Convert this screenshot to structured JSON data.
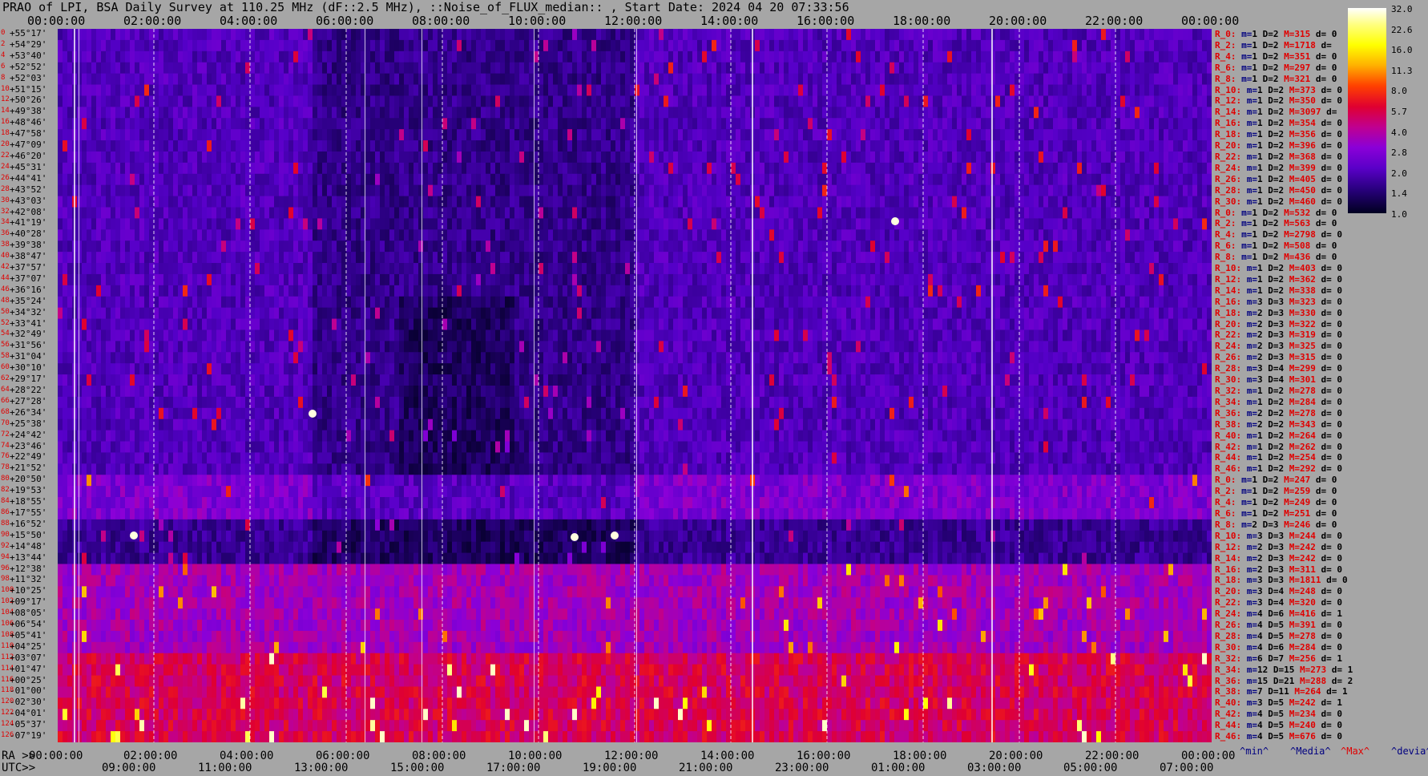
{
  "title": "PRAO of LPI, BSA Daily Survey at 110.25 MHz (dF::2.5 MHz), ::Noise_of_FLUX_median:: , Start Date: 2024 04 20 07:33:56",
  "chart_data": {
    "type": "heatmap",
    "title": "PRAO of LPI, BSA Daily Survey at 110.25 MHz (dF::2.5 MHz), ::Noise_of_FLUX_median:: , Start Date: 2024 04 20 07:33:56",
    "x_top_ticks": [
      "00:00:00",
      "02:00:00",
      "04:00:00",
      "06:00:00",
      "08:00:00",
      "10:00:00",
      "12:00:00",
      "14:00:00",
      "16:00:00",
      "18:00:00",
      "20:00:00",
      "22:00:00",
      "00:00:00"
    ],
    "x_bottom_ra_prefix": "RA >>",
    "x_bottom_ra_ticks": [
      "00:00:00",
      "02:00:00",
      "04:00:00",
      "06:00:00",
      "08:00:00",
      "10:00:00",
      "12:00:00",
      "14:00:00",
      "16:00:00",
      "18:00:00",
      "20:00:00",
      "22:00:00",
      "00:00:00"
    ],
    "x_bottom_utc_prefix": "UTC>>",
    "x_bottom_utc_ticks": [
      "09:00:00",
      "11:00:00",
      "13:00:00",
      "15:00:00",
      "17:00:00",
      "19:00:00",
      "21:00:00",
      "23:00:00",
      "01:00:00",
      "03:00:00",
      "05:00:00",
      "07:00:00"
    ],
    "colorbar_ticks": [
      "32.0",
      "22.6",
      "16.0",
      "11.3",
      "8.0",
      "5.7",
      "4.0",
      "2.8",
      "2.0",
      "1.4",
      "1.0"
    ],
    "footer_labels": [
      "^min^",
      "^Media^",
      "^Max^",
      "^devia^"
    ],
    "rows": [
      {
        "i": "0",
        "dec": "+55°17'",
        "r": "R_0:",
        "m": "1",
        "D": "2",
        "M": "315",
        "d": "0"
      },
      {
        "i": "2",
        "dec": "+54°29'",
        "r": "R_2:",
        "m": "1",
        "D": "2",
        "M": "1718",
        "d": ""
      },
      {
        "i": "4",
        "dec": "+53°40'",
        "r": "R_4:",
        "m": "1",
        "D": "2",
        "M": "351",
        "d": "0"
      },
      {
        "i": "6",
        "dec": "+52°52'",
        "r": "R_6:",
        "m": "1",
        "D": "2",
        "M": "297",
        "d": "0"
      },
      {
        "i": "8",
        "dec": "+52°03'",
        "r": "R_8:",
        "m": "1",
        "D": "2",
        "M": "321",
        "d": "0"
      },
      {
        "i": "10",
        "dec": "+51°15'",
        "r": "R_10:",
        "m": "1",
        "D": "2",
        "M": "373",
        "d": "0"
      },
      {
        "i": "12",
        "dec": "+50°26'",
        "r": "R_12:",
        "m": "1",
        "D": "2",
        "M": "350",
        "d": "0"
      },
      {
        "i": "14",
        "dec": "+49°38'",
        "r": "R_14:",
        "m": "1",
        "D": "2",
        "M": "3097",
        "d": ""
      },
      {
        "i": "16",
        "dec": "+48°46'",
        "r": "R_16:",
        "m": "1",
        "D": "2",
        "M": "354",
        "d": "0"
      },
      {
        "i": "18",
        "dec": "+47°58'",
        "r": "R_18:",
        "m": "1",
        "D": "2",
        "M": "356",
        "d": "0"
      },
      {
        "i": "20",
        "dec": "+47°09'",
        "r": "R_20:",
        "m": "1",
        "D": "2",
        "M": "396",
        "d": "0"
      },
      {
        "i": "22",
        "dec": "+46°20'",
        "r": "R_22:",
        "m": "1",
        "D": "2",
        "M": "368",
        "d": "0"
      },
      {
        "i": "24",
        "dec": "+45°31'",
        "r": "R_24:",
        "m": "1",
        "D": "2",
        "M": "399",
        "d": "0"
      },
      {
        "i": "26",
        "dec": "+44°41'",
        "r": "R_26:",
        "m": "1",
        "D": "2",
        "M": "405",
        "d": "0"
      },
      {
        "i": "28",
        "dec": "+43°52'",
        "r": "R_28:",
        "m": "1",
        "D": "2",
        "M": "450",
        "d": "0"
      },
      {
        "i": "30",
        "dec": "+43°03'",
        "r": "R_30:",
        "m": "1",
        "D": "2",
        "M": "460",
        "d": "0"
      },
      {
        "i": "32",
        "dec": "+42°08'",
        "r": "R_0:",
        "m": "1",
        "D": "2",
        "M": "532",
        "d": "0"
      },
      {
        "i": "34",
        "dec": "+41°19'",
        "r": "R_2:",
        "m": "1",
        "D": "2",
        "M": "563",
        "d": "0"
      },
      {
        "i": "36",
        "dec": "+40°28'",
        "r": "R_4:",
        "m": "1",
        "D": "2",
        "M": "2798",
        "d": "0"
      },
      {
        "i": "38",
        "dec": "+39°38'",
        "r": "R_6:",
        "m": "1",
        "D": "2",
        "M": "508",
        "d": "0"
      },
      {
        "i": "40",
        "dec": "+38°47'",
        "r": "R_8:",
        "m": "1",
        "D": "2",
        "M": "436",
        "d": "0"
      },
      {
        "i": "42",
        "dec": "+37°57'",
        "r": "R_10:",
        "m": "1",
        "D": "2",
        "M": "403",
        "d": "0"
      },
      {
        "i": "44",
        "dec": "+37°07'",
        "r": "R_12:",
        "m": "1",
        "D": "2",
        "M": "362",
        "d": "0"
      },
      {
        "i": "46",
        "dec": "+36°16'",
        "r": "R_14:",
        "m": "1",
        "D": "2",
        "M": "338",
        "d": "0"
      },
      {
        "i": "48",
        "dec": "+35°24'",
        "r": "R_16:",
        "m": "3",
        "D": "3",
        "M": "323",
        "d": "0"
      },
      {
        "i": "50",
        "dec": "+34°32'",
        "r": "R_18:",
        "m": "2",
        "D": "3",
        "M": "330",
        "d": "0"
      },
      {
        "i": "52",
        "dec": "+33°41'",
        "r": "R_20:",
        "m": "2",
        "D": "3",
        "M": "322",
        "d": "0"
      },
      {
        "i": "54",
        "dec": "+32°49'",
        "r": "R_22:",
        "m": "2",
        "D": "3",
        "M": "319",
        "d": "0"
      },
      {
        "i": "56",
        "dec": "+31°56'",
        "r": "R_24:",
        "m": "2",
        "D": "3",
        "M": "325",
        "d": "0"
      },
      {
        "i": "58",
        "dec": "+31°04'",
        "r": "R_26:",
        "m": "2",
        "D": "3",
        "M": "315",
        "d": "0"
      },
      {
        "i": "60",
        "dec": "+30°10'",
        "r": "R_28:",
        "m": "3",
        "D": "4",
        "M": "299",
        "d": "0"
      },
      {
        "i": "62",
        "dec": "+29°17'",
        "r": "R_30:",
        "m": "3",
        "D": "4",
        "M": "301",
        "d": "0"
      },
      {
        "i": "64",
        "dec": "+28°22'",
        "r": "R_32:",
        "m": "1",
        "D": "2",
        "M": "278",
        "d": "0"
      },
      {
        "i": "66",
        "dec": "+27°28'",
        "r": "R_34:",
        "m": "1",
        "D": "2",
        "M": "284",
        "d": "0"
      },
      {
        "i": "68",
        "dec": "+26°34'",
        "r": "R_36:",
        "m": "2",
        "D": "2",
        "M": "278",
        "d": "0"
      },
      {
        "i": "70",
        "dec": "+25°38'",
        "r": "R_38:",
        "m": "2",
        "D": "2",
        "M": "343",
        "d": "0"
      },
      {
        "i": "72",
        "dec": "+24°42'",
        "r": "R_40:",
        "m": "1",
        "D": "2",
        "M": "264",
        "d": "0"
      },
      {
        "i": "74",
        "dec": "+23°46'",
        "r": "R_42:",
        "m": "1",
        "D": "2",
        "M": "262",
        "d": "0"
      },
      {
        "i": "76",
        "dec": "+22°49'",
        "r": "R_44:",
        "m": "1",
        "D": "2",
        "M": "254",
        "d": "0"
      },
      {
        "i": "78",
        "dec": "+21°52'",
        "r": "R_46:",
        "m": "1",
        "D": "2",
        "M": "292",
        "d": "0"
      },
      {
        "i": "80",
        "dec": "+20°50'",
        "r": "R_0:",
        "m": "1",
        "D": "2",
        "M": "247",
        "d": "0"
      },
      {
        "i": "82",
        "dec": "+19°53'",
        "r": "R_2:",
        "m": "1",
        "D": "2",
        "M": "259",
        "d": "0"
      },
      {
        "i": "84",
        "dec": "+18°55'",
        "r": "R_4:",
        "m": "1",
        "D": "2",
        "M": "249",
        "d": "0"
      },
      {
        "i": "86",
        "dec": "+17°55'",
        "r": "R_6:",
        "m": "1",
        "D": "2",
        "M": "251",
        "d": "0"
      },
      {
        "i": "88",
        "dec": "+16°52'",
        "r": "R_8:",
        "m": "2",
        "D": "3",
        "M": "246",
        "d": "0"
      },
      {
        "i": "90",
        "dec": "+15°50'",
        "r": "R_10:",
        "m": "3",
        "D": "3",
        "M": "244",
        "d": "0"
      },
      {
        "i": "92",
        "dec": "+14°48'",
        "r": "R_12:",
        "m": "2",
        "D": "3",
        "M": "242",
        "d": "0"
      },
      {
        "i": "94",
        "dec": "+13°44'",
        "r": "R_14:",
        "m": "2",
        "D": "3",
        "M": "242",
        "d": "0"
      },
      {
        "i": "96",
        "dec": "+12°38'",
        "r": "R_16:",
        "m": "2",
        "D": "3",
        "M": "311",
        "d": "0"
      },
      {
        "i": "98",
        "dec": "+11°32'",
        "r": "R_18:",
        "m": "3",
        "D": "3",
        "M": "1811",
        "d": "0"
      },
      {
        "i": "100",
        "dec": "+10°25'",
        "r": "R_20:",
        "m": "3",
        "D": "4",
        "M": "248",
        "d": "0"
      },
      {
        "i": "102",
        "dec": "+09°17'",
        "r": "R_22:",
        "m": "3",
        "D": "4",
        "M": "320",
        "d": "0"
      },
      {
        "i": "104",
        "dec": "+08°05'",
        "r": "R_24:",
        "m": "4",
        "D": "6",
        "M": "416",
        "d": "1"
      },
      {
        "i": "106",
        "dec": "+06°54'",
        "r": "R_26:",
        "m": "4",
        "D": "5",
        "M": "391",
        "d": "0"
      },
      {
        "i": "108",
        "dec": "+05°41'",
        "r": "R_28:",
        "m": "4",
        "D": "5",
        "M": "278",
        "d": "0"
      },
      {
        "i": "110",
        "dec": "+04°25'",
        "r": "R_30:",
        "m": "4",
        "D": "6",
        "M": "284",
        "d": "0"
      },
      {
        "i": "112",
        "dec": "+03°07'",
        "r": "R_32:",
        "m": "6",
        "D": "7",
        "M": "256",
        "d": "1"
      },
      {
        "i": "114",
        "dec": "+01°47'",
        "r": "R_34:",
        "m": "12",
        "D": "15",
        "M": "273",
        "d": "1"
      },
      {
        "i": "116",
        "dec": "+00°25'",
        "r": "R_36:",
        "m": "15",
        "D": "21",
        "M": "288",
        "d": "2"
      },
      {
        "i": "118",
        "dec": "-01°00'",
        "r": "R_38:",
        "m": "7",
        "D": "11",
        "M": "264",
        "d": "1"
      },
      {
        "i": "120",
        "dec": "-02°30'",
        "r": "R_40:",
        "m": "3",
        "D": "5",
        "M": "242",
        "d": "1"
      },
      {
        "i": "122",
        "dec": "-04°01'",
        "r": "R_42:",
        "m": "4",
        "D": "5",
        "M": "234",
        "d": "0"
      },
      {
        "i": "124",
        "dec": "-05°37'",
        "r": "R_44:",
        "m": "4",
        "D": "5",
        "M": "240",
        "d": "0"
      },
      {
        "i": "126",
        "dec": "-07°19'",
        "r": "R_46:",
        "m": "4",
        "D": "5",
        "M": "676",
        "d": "0"
      }
    ]
  }
}
